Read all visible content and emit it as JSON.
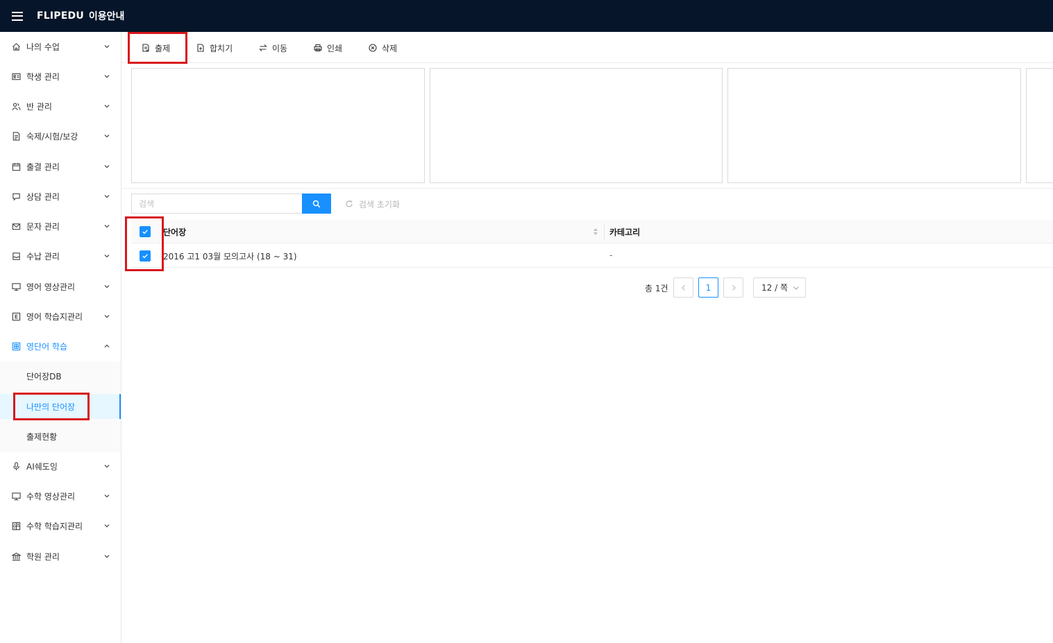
{
  "header": {
    "brand": "FLIPEDU",
    "guide": "이용안내"
  },
  "sidebar": {
    "items": [
      {
        "label": "나의 수업",
        "icon": "home-icon"
      },
      {
        "label": "학생 관리",
        "icon": "id-card-icon"
      },
      {
        "label": "반 관리",
        "icon": "users-icon"
      },
      {
        "label": "숙제/시험/보강",
        "icon": "file-icon"
      },
      {
        "label": "출결 관리",
        "icon": "calendar-icon"
      },
      {
        "label": "상담 관리",
        "icon": "chat-icon"
      },
      {
        "label": "문자 관리",
        "icon": "mail-icon"
      },
      {
        "label": "수납 관리",
        "icon": "receipt-icon"
      },
      {
        "label": "영어 영상관리",
        "icon": "monitor-icon"
      },
      {
        "label": "영어 학습지관리",
        "icon": "letter-e-icon"
      },
      {
        "label": "영단어 학습",
        "icon": "book-icon"
      }
    ],
    "subitems": [
      {
        "label": "단어장DB"
      },
      {
        "label": "나만의 단어장"
      },
      {
        "label": "출제현황"
      }
    ],
    "bottom_items": [
      {
        "label": "AI쉐도잉",
        "icon": "microphone-icon"
      },
      {
        "label": "수학 영상관리",
        "icon": "monitor-icon"
      },
      {
        "label": "수학 학습지관리",
        "icon": "calculator-icon"
      },
      {
        "label": "학원 관리",
        "icon": "building-icon"
      }
    ]
  },
  "toolbar": {
    "assign_label": "출제",
    "merge_label": "합치기",
    "move_label": "이동",
    "print_label": "인쇄",
    "delete_label": "삭제"
  },
  "search": {
    "placeholder": "검색",
    "reset_label": "검색 초기화"
  },
  "table": {
    "headers": [
      "단어장",
      "카테고리"
    ],
    "rows": [
      {
        "name": "2016 고1 03월 모의고사 (18 ~ 31)",
        "category": "-"
      }
    ]
  },
  "pagination": {
    "total": "총 1건",
    "current_page": "1",
    "page_size": "12 / 쪽"
  },
  "colors": {
    "header_bg": "#061529",
    "accent": "#1890ff",
    "highlight": "#d9161c"
  }
}
